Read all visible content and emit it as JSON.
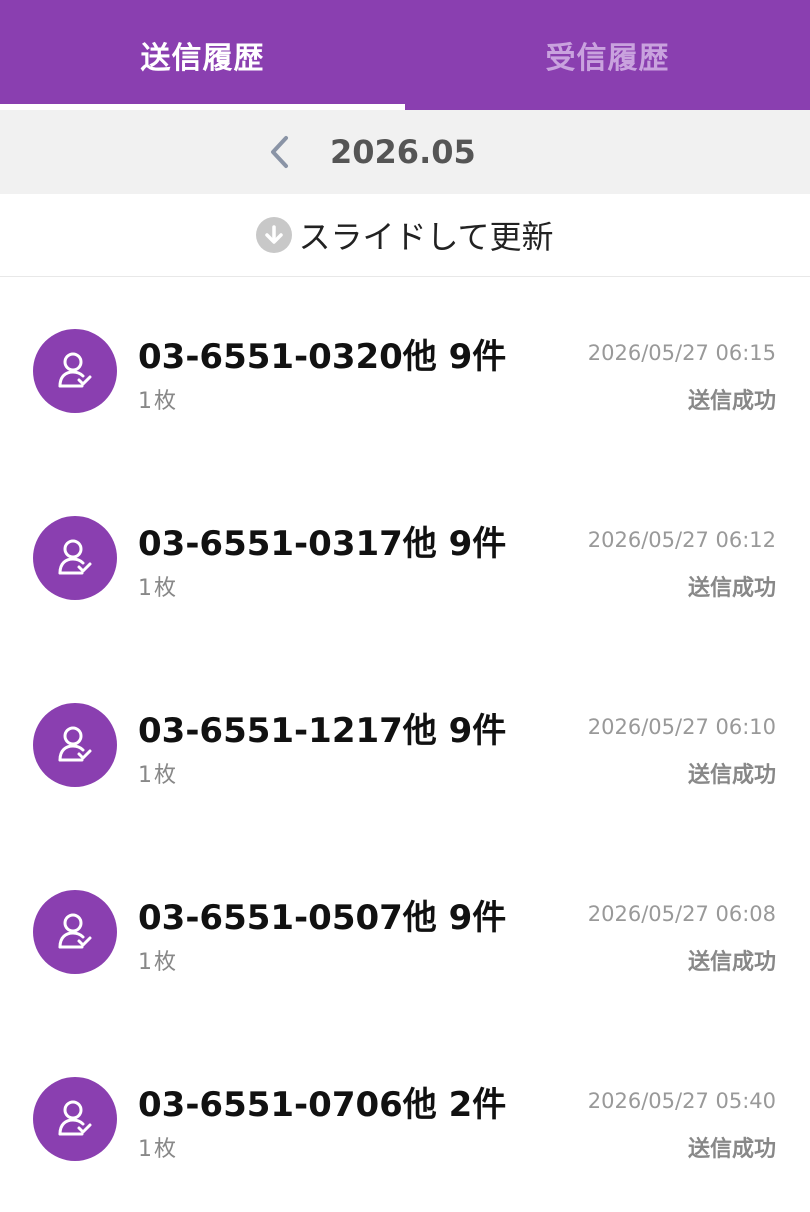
{
  "tabs": {
    "sent": "送信履歴",
    "received": "受信履歴"
  },
  "month_nav": {
    "prev_icon": "chevron-left-icon",
    "month": "2026.05"
  },
  "refresh": {
    "icon": "arrow-down-circle-icon",
    "text": "スライドして更新"
  },
  "colors": {
    "accent": "#8a3fb0",
    "inactive_tab": "#c9a2de"
  },
  "history": [
    {
      "title": "03-6551-0320他 9件",
      "pages": "1枚",
      "datetime": "2026/05/27 06:15",
      "status": "送信成功"
    },
    {
      "title": "03-6551-0317他 9件",
      "pages": "1枚",
      "datetime": "2026/05/27 06:12",
      "status": "送信成功"
    },
    {
      "title": "03-6551-1217他 9件",
      "pages": "1枚",
      "datetime": "2026/05/27 06:10",
      "status": "送信成功"
    },
    {
      "title": "03-6551-0507他 9件",
      "pages": "1枚",
      "datetime": "2026/05/27 06:08",
      "status": "送信成功"
    },
    {
      "title": "03-6551-0706他 2件",
      "pages": "1枚",
      "datetime": "2026/05/27 05:40",
      "status": "送信成功"
    }
  ]
}
